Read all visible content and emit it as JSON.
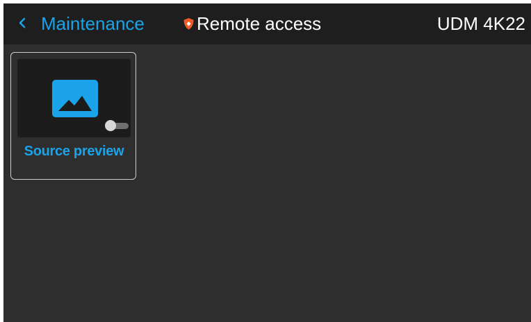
{
  "header": {
    "back_icon": "chevron-left-icon",
    "back_label": "Maintenance",
    "status_icon": "shield-icon",
    "status_label": "Remote access",
    "device_name": "UDM 4K22"
  },
  "tiles": [
    {
      "label": "Source preview",
      "icon": "image-icon",
      "toggle_on": false
    }
  ],
  "colors": {
    "accent": "#1aa3e8",
    "header_bg": "#1e1e1e",
    "page_bg": "#2e2e2e",
    "warning": "#f15a24"
  }
}
